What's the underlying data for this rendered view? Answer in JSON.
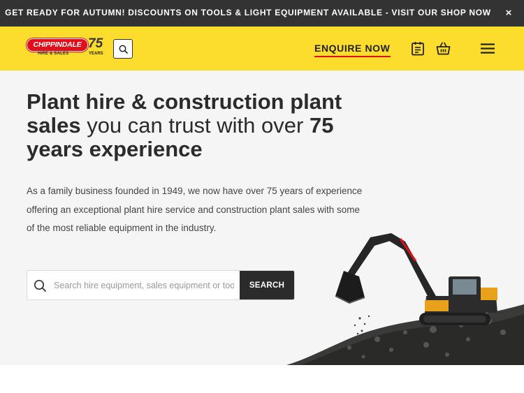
{
  "announcement": {
    "text": "GET READY FOR AUTUMN! DISCOUNTS ON TOOLS & LIGHT EQUIPMENT AVAILABLE - VISIT OUR SHOP NOW",
    "close_icon": "×"
  },
  "header": {
    "logo": {
      "brand": "CHIPPINDALE",
      "tagline": "HIRE & SALES",
      "anniversary": "75",
      "anniversary_label": "YEARS"
    },
    "enquire_label": "ENQUIRE NOW",
    "icons": [
      "search-icon",
      "clipboard-list-icon",
      "basket-icon",
      "menu-icon"
    ]
  },
  "hero": {
    "headline": {
      "part1": "Plant hire & construction plant sales",
      "part2": " you can trust with over ",
      "part3": "75 years experience"
    },
    "intro": "As a family business founded in 1949, we now have over 75 years of experience offering an exceptional plant hire service and construction plant sales with some of the most reliable equipment in the industry.",
    "search": {
      "placeholder": "Search hire equipment, sales equipment or tools...",
      "value": "",
      "button_label": "SEARCH"
    }
  },
  "colors": {
    "brand_yellow": "#fcdc2c",
    "dark": "#2b2b2b",
    "accent_red": "#e0101a"
  }
}
